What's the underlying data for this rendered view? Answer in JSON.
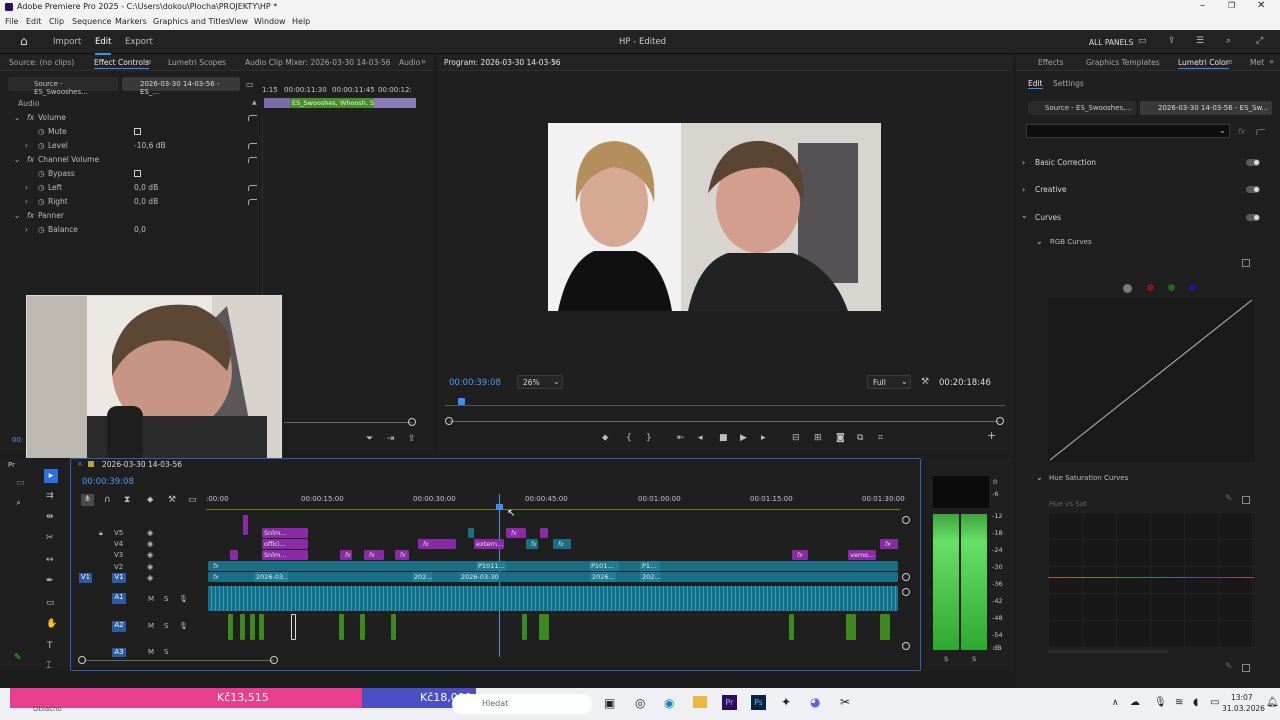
{
  "window": {
    "title": "Adobe Premiere Pro 2025 - C:\\Users\\dokou\\Plocha\\PROJEKTY\\HP *"
  },
  "menu": [
    "File",
    "Edit",
    "Clip",
    "Sequence",
    "Markers",
    "Graphics and Titles",
    "View",
    "Window",
    "Help"
  ],
  "topbar": {
    "import": "Import",
    "edit": "Edit",
    "export": "Export",
    "project": "HP - Edited",
    "all_panels": "ALL PANELS"
  },
  "source_panel": {
    "tabs": [
      "Source: (no clips)",
      "Effect Controls",
      "Lumetri Scopes",
      "Audio Clip Mixer: 2026-03-30 14-03-56",
      "Audio"
    ],
    "clip_source": "Source - ES_Swooshes...",
    "clip_seq": "2026-03-30 14-03-56 - ES_...",
    "mini_ticks": [
      "1:15",
      "00:00:11:30",
      "00:00:11:45",
      "00:00:12:"
    ],
    "mini_clip": "ES_Swooshes, Whoosh, S",
    "section": "Audio",
    "volume": "Volume",
    "mute": "Mute",
    "level": "Level",
    "level_value": "-10,6 dB",
    "channel_volume": "Channel Volume",
    "bypass": "Bypass",
    "left": "Left",
    "left_value": "0,0 dB",
    "right": "Right",
    "right_value": "0,0 dB",
    "panner": "Panner",
    "balance": "Balance",
    "balance_value": "0,0",
    "timecode_stub": "00:"
  },
  "program": {
    "title": "Program: 2026-03-30 14-03-56",
    "timecode": "00:00:39:08",
    "zoom": "26%",
    "quality": "Full",
    "duration": "00:20:18:46"
  },
  "timeline": {
    "tab_left": "Pr",
    "sequence": "2026-03-30 14-03-56",
    "timecode": "00:00:39:08",
    "ruler": [
      ":00:00",
      "00:00:15:00",
      "00:00:30:00",
      "00:00:45:00",
      "00:01:00:00",
      "00:01:15:00",
      "00:01:30:00"
    ],
    "video_tracks": [
      "V5",
      "V4",
      "V3",
      "V2",
      "V1"
    ],
    "audio_tracks": [
      "A1",
      "A2",
      "A3"
    ],
    "v1_source": "V1",
    "clip_labels": {
      "v5a": "Snîm...",
      "v4a": "offici...",
      "v4b": "extern...",
      "v3a": "Snîm...",
      "v3b": "vemo...",
      "v2a": "P1011...",
      "v2b": "P101...",
      "v2c": "P1...",
      "v1a": "2026-03...",
      "v1b": "202...",
      "v1c": "2026-03-30...",
      "v1d": "2026...",
      "v1e": "202..."
    },
    "fx": "fx",
    "m": "M",
    "s": "S"
  },
  "meter": {
    "scale": [
      "0",
      "-6",
      "-12",
      "-18",
      "-24",
      "-30",
      "-36",
      "-42",
      "-48",
      "-54",
      "dB"
    ],
    "solo": [
      "S",
      "S"
    ]
  },
  "right_panel": {
    "tabs": [
      "Effects",
      "Graphics Templates",
      "Lumetri Color",
      "Met"
    ],
    "subtabs": [
      "Edit",
      "Settings"
    ],
    "clip_source": "Source - ES_Swooshes,...",
    "clip_seq": "2026-03-30 14-03-56 - ES_Sw...",
    "basic_correction": "Basic Correction",
    "creative": "Creative",
    "curves": "Curves",
    "rgb_curves": "RGB Curves",
    "hue_sat_curves": "Hue Saturation Curves",
    "hue_vs_sat": "Hue vs Sat",
    "channel_colors": [
      "#7a7a7a",
      "#7a1a1a",
      "#1a6a1a",
      "#1a1a8a"
    ]
  },
  "taskbar": {
    "weather": "Oblačno",
    "search": "Hledat",
    "time": "13:07",
    "date": "31.03.2026",
    "banner_pink": "Kč13,515",
    "banner_blue": "Kč18,000"
  },
  "colors": {
    "accent": "#3d8bff",
    "timecode": "#4b9bff",
    "banner_pink": "#e93d8e",
    "banner_blue": "#4a4fc4"
  }
}
